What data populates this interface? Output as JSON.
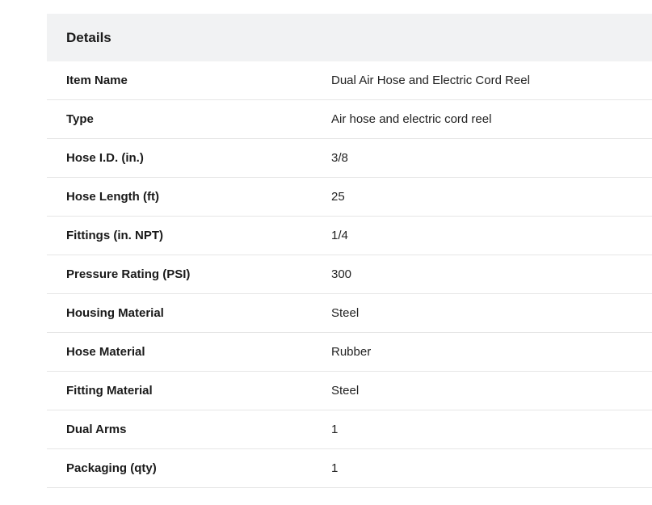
{
  "details": {
    "title": "Details",
    "rows": [
      {
        "label": "Item Name",
        "value": "Dual Air Hose and Electric Cord Reel"
      },
      {
        "label": "Type",
        "value": "Air hose and electric cord reel"
      },
      {
        "label": "Hose I.D. (in.)",
        "value": "3/8"
      },
      {
        "label": "Hose Length (ft)",
        "value": "25"
      },
      {
        "label": "Fittings (in. NPT)",
        "value": "1/4"
      },
      {
        "label": "Pressure Rating (PSI)",
        "value": "300"
      },
      {
        "label": "Housing Material",
        "value": "Steel"
      },
      {
        "label": "Hose Material",
        "value": "Rubber"
      },
      {
        "label": "Fitting Material",
        "value": "Steel"
      },
      {
        "label": "Dual Arms",
        "value": "1"
      },
      {
        "label": "Packaging (qty)",
        "value": "1"
      }
    ]
  },
  "colors": {
    "header_background": "#f1f2f3",
    "row_divider": "#e6e6e6",
    "text": "#1a1a1a"
  }
}
